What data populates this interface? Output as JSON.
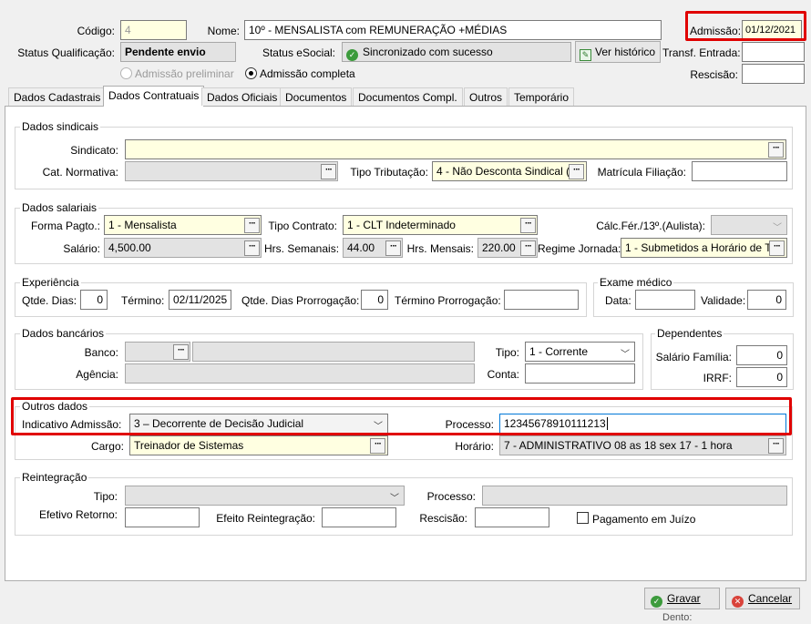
{
  "header": {
    "codigo_label": "Código:",
    "codigo_value": "4",
    "nome_label": "Nome:",
    "nome_value": "10º -  MENSALISTA com REMUNERAÇÃO +MÉDIAS",
    "admissao_label": "Admissão:",
    "admissao_value": "01/12/2021",
    "status_qual_label": "Status Qualificação:",
    "status_qual_value": "Pendente envio",
    "status_esocial_label": "Status eSocial:",
    "status_esocial_value": "Sincronizado com sucesso",
    "ver_historico": "Ver histórico",
    "transf_label": "Transf. Entrada:",
    "rescisao_label": "Rescisão:",
    "adm_preliminar": "Admissão preliminar",
    "adm_completa": "Admissão completa"
  },
  "tabs": [
    "Dados Cadastrais",
    "Dados Contratuais",
    "Dados Oficiais",
    "Documentos",
    "Documentos Compl.",
    "Outros",
    "Temporário"
  ],
  "sindicais": {
    "title": "Dados sindicais",
    "sindicato_label": "Sindicato:",
    "cat_label": "Cat. Normativa:",
    "tipo_trib_label": "Tipo Tributação:",
    "tipo_trib_value": "4 - Não Desconta Sindical (",
    "matricula_label": "Matrícula Filiação:"
  },
  "salariais": {
    "title": "Dados salariais",
    "forma_label": "Forma Pagto.:",
    "forma_value": "1  -  Mensalista",
    "tipo_contrato_label": "Tipo Contrato:",
    "tipo_contrato_value": "1 - CLT Indeterminado",
    "calc_label": "Cálc.Fér./13º.(Aulista):",
    "salario_label": "Salário:",
    "salario_value": "4,500.00",
    "hrs_sem_label": "Hrs. Semanais:",
    "hrs_sem_value": "44.00",
    "hrs_mes_label": "Hrs. Mensais:",
    "hrs_mes_value": "220.00",
    "regime_label": "Regime Jornada:",
    "regime_value": "1 - Submetidos a Horário de T"
  },
  "experiencia": {
    "title": "Experiência",
    "qtde_label": "Qtde. Dias:",
    "qtde_value": "0",
    "termino_label": "Término:",
    "termino_value": "02/11/2025",
    "prorrog_label": "Qtde. Dias Prorrogação:",
    "prorrog_value": "0",
    "term_prorrog_label": "Término Prorrogação:"
  },
  "exame": {
    "title": "Exame médico",
    "data_label": "Data:",
    "validade_label": "Validade:",
    "validade_value": "0"
  },
  "bancarios": {
    "title": "Dados bancários",
    "banco_label": "Banco:",
    "agencia_label": "Agência:",
    "tipo_label": "Tipo:",
    "tipo_value": "1 - Corrente",
    "conta_label": "Conta:"
  },
  "dependentes": {
    "title": "Dependentes",
    "sal_fam_label": "Salário Família:",
    "sal_fam_value": "0",
    "irrf_label": "IRRF:",
    "irrf_value": "0"
  },
  "outros": {
    "title": "Outros dados",
    "ind_adm_label": "Indicativo Admissão:",
    "ind_adm_value": "3 – Decorrente de Decisão Judicial",
    "processo_label": "Processo:",
    "processo_value": "12345678910111213",
    "cargo_label": "Cargo:",
    "cargo_value": "Treinador de Sistemas",
    "horario_label": "Horário:",
    "horario_value": "7 - ADMINISTRATIVO 08 as 18 sex 17 - 1 hora"
  },
  "reintegracao": {
    "title": "Reintegração",
    "tipo_label": "Tipo:",
    "processo_label": "Processo:",
    "efetivo_label": "Efetivo Retorno:",
    "efeito_label": "Efeito Reintegração:",
    "rescisao_label": "Rescisão:",
    "pag_juizo_label": "Pagamento em Juízo"
  },
  "footer": {
    "gravar": "Gravar",
    "cancelar": "Cancelar",
    "cut_text": "Dento:"
  },
  "colors": {
    "highlight": "#e00000",
    "yellow_field": "#ffffe1",
    "ok_green": "#3c9b3c",
    "cancel_red": "#d9433b"
  }
}
